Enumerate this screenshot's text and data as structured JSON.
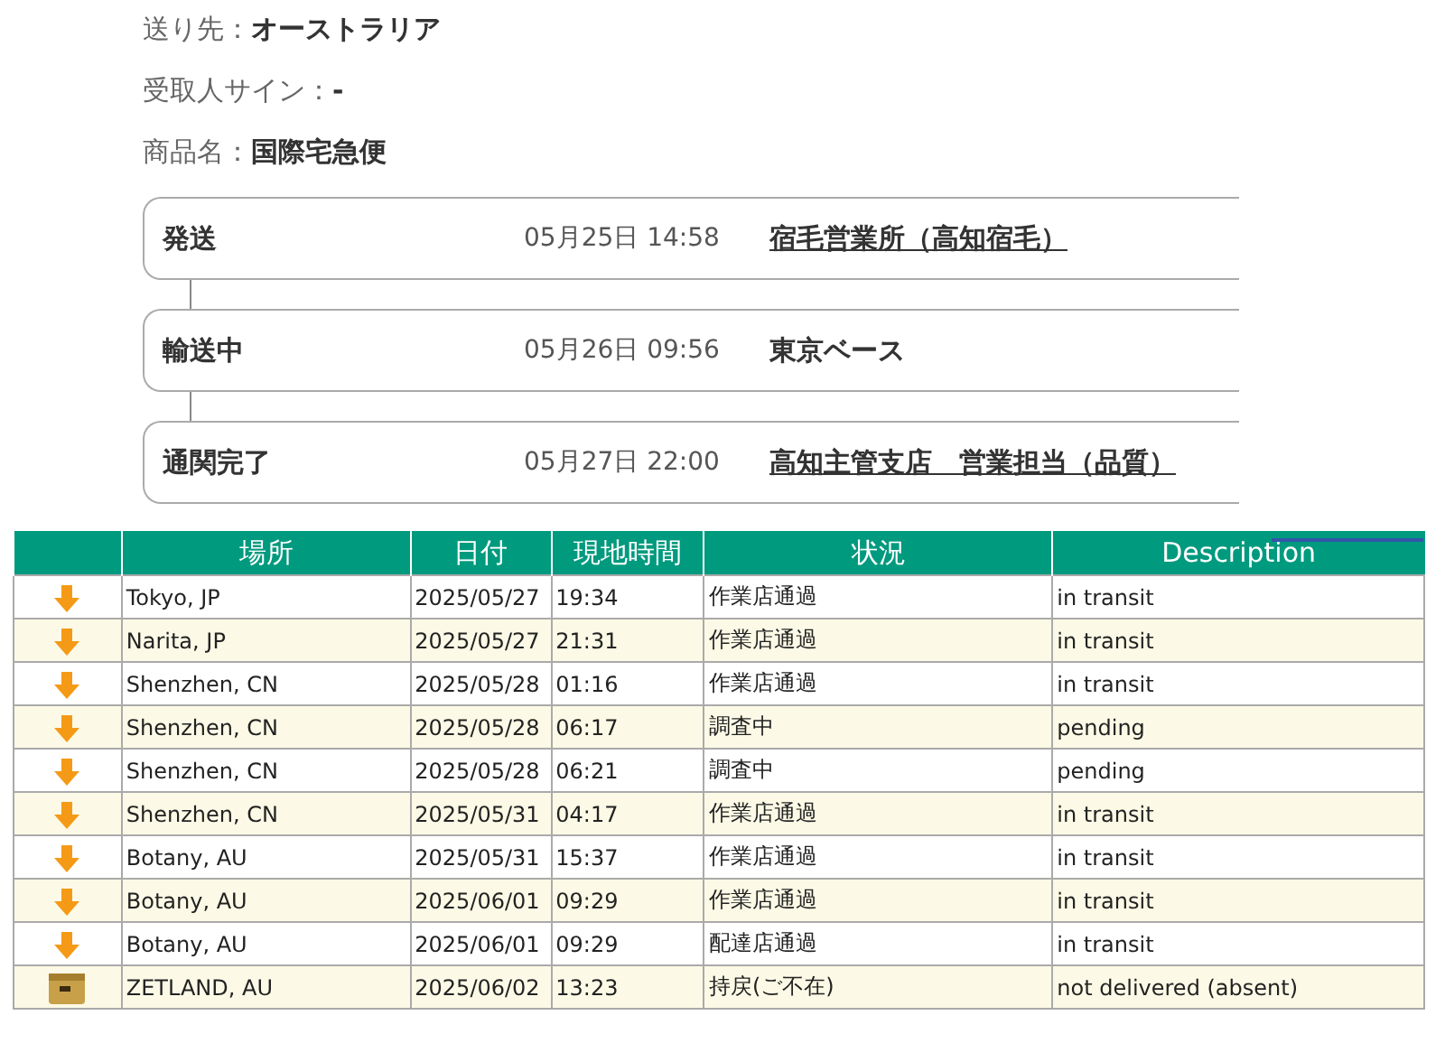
{
  "info": [
    {
      "label": "送り先：",
      "value": "オーストラリア"
    },
    {
      "label": "受取人サイン：",
      "value": "-"
    },
    {
      "label": "商品名：",
      "value": "国際宅急便"
    }
  ],
  "timeline": [
    {
      "status": "発送",
      "time": "05月25日 14:58",
      "place": "宿毛営業所（高知宿毛）",
      "linked": true
    },
    {
      "status": "輸送中",
      "time": "05月26日 09:56",
      "place": "東京ベース",
      "linked": false
    },
    {
      "status": "通関完了",
      "time": "05月27日 22:00",
      "place": "高知主管支店　営業担当（品質）",
      "linked": true
    }
  ],
  "table": {
    "columns": [
      "場所",
      "日付",
      "現地時間",
      "状況",
      "Description"
    ],
    "rows": [
      {
        "kind": "arrow",
        "place": "Tokyo, JP",
        "date": "2025/05/27",
        "time": "19:34",
        "status": "作業店通過",
        "description": "in transit"
      },
      {
        "kind": "arrow",
        "place": "Narita, JP",
        "date": "2025/05/27",
        "time": "21:31",
        "status": "作業店通過",
        "description": "in transit"
      },
      {
        "kind": "arrow",
        "place": "Shenzhen, CN",
        "date": "2025/05/28",
        "time": "01:16",
        "status": "作業店通過",
        "description": "in transit"
      },
      {
        "kind": "arrow",
        "place": "Shenzhen, CN",
        "date": "2025/05/28",
        "time": "06:17",
        "status": "調査中",
        "description": "pending"
      },
      {
        "kind": "arrow",
        "place": "Shenzhen, CN",
        "date": "2025/05/28",
        "time": "06:21",
        "status": "調査中",
        "description": "pending"
      },
      {
        "kind": "arrow",
        "place": "Shenzhen, CN",
        "date": "2025/05/31",
        "time": "04:17",
        "status": "作業店通過",
        "description": "in transit"
      },
      {
        "kind": "arrow",
        "place": "Botany, AU",
        "date": "2025/05/31",
        "time": "15:37",
        "status": "作業店通過",
        "description": "in transit"
      },
      {
        "kind": "arrow",
        "place": "Botany, AU",
        "date": "2025/06/01",
        "time": "09:29",
        "status": "作業店通過",
        "description": "in transit"
      },
      {
        "kind": "arrow",
        "place": "Botany, AU",
        "date": "2025/06/01",
        "time": "09:29",
        "status": "配達店通過",
        "description": "in transit"
      },
      {
        "kind": "box",
        "place": "ZETLAND, AU",
        "date": "2025/06/02",
        "time": "13:23",
        "status": "持戻(ご不在)",
        "description": "not delivered (absent)"
      }
    ]
  }
}
